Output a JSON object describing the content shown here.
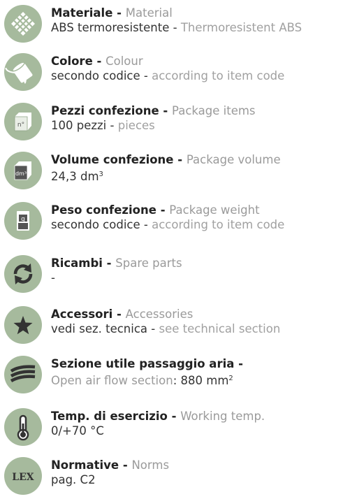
{
  "specs": [
    {
      "icon": "material-diamond-icon",
      "label_it": "Materiale",
      "label_en": "Material",
      "value_it": "ABS termoresistente",
      "value_en": "Thermoresistent ABS"
    },
    {
      "icon": "paint-bucket-icon",
      "label_it": "Colore",
      "label_en": "Colour",
      "value_it": "secondo codice",
      "value_en": "according to item code"
    },
    {
      "icon": "package-count-icon",
      "icon_text": "n°",
      "label_it": "Pezzi confezione",
      "label_en": "Package items",
      "value_it": "100 pezzi",
      "value_en": "pieces"
    },
    {
      "icon": "package-volume-icon",
      "icon_text": "dm³",
      "label_it": "Volume confezione",
      "label_en": "Package volume",
      "value": "24,3 dm",
      "value_sup": "3"
    },
    {
      "icon": "weight-icon",
      "icon_text": "g",
      "label_it": "Peso confezione",
      "label_en": "Package weight",
      "value_it": "secondo codice",
      "value_en": "according to item code"
    },
    {
      "icon": "spare-parts-icon",
      "label_it": "Ricambi",
      "label_en": "Spare parts",
      "value": "-"
    },
    {
      "icon": "star-icon",
      "label_it": "Accessori",
      "label_en": "Accessories",
      "value_it": "vedi sez. tecnica",
      "value_en": "see technical section"
    },
    {
      "icon": "airflow-icon",
      "label_it": "Sezione utile passaggio aria",
      "label_en": "Open air flow section",
      "value": "880 mm",
      "value_sup": "2"
    },
    {
      "icon": "thermometer-icon",
      "label_it": "Temp. di esercizio",
      "label_en": "Working temp.",
      "value": "0/+70 °C"
    },
    {
      "icon": "lex-icon",
      "icon_text": "LEX",
      "label_it": "Normative",
      "label_en": "Norms",
      "value": "pag. C2"
    }
  ],
  "separator": " - ",
  "colon": ": "
}
